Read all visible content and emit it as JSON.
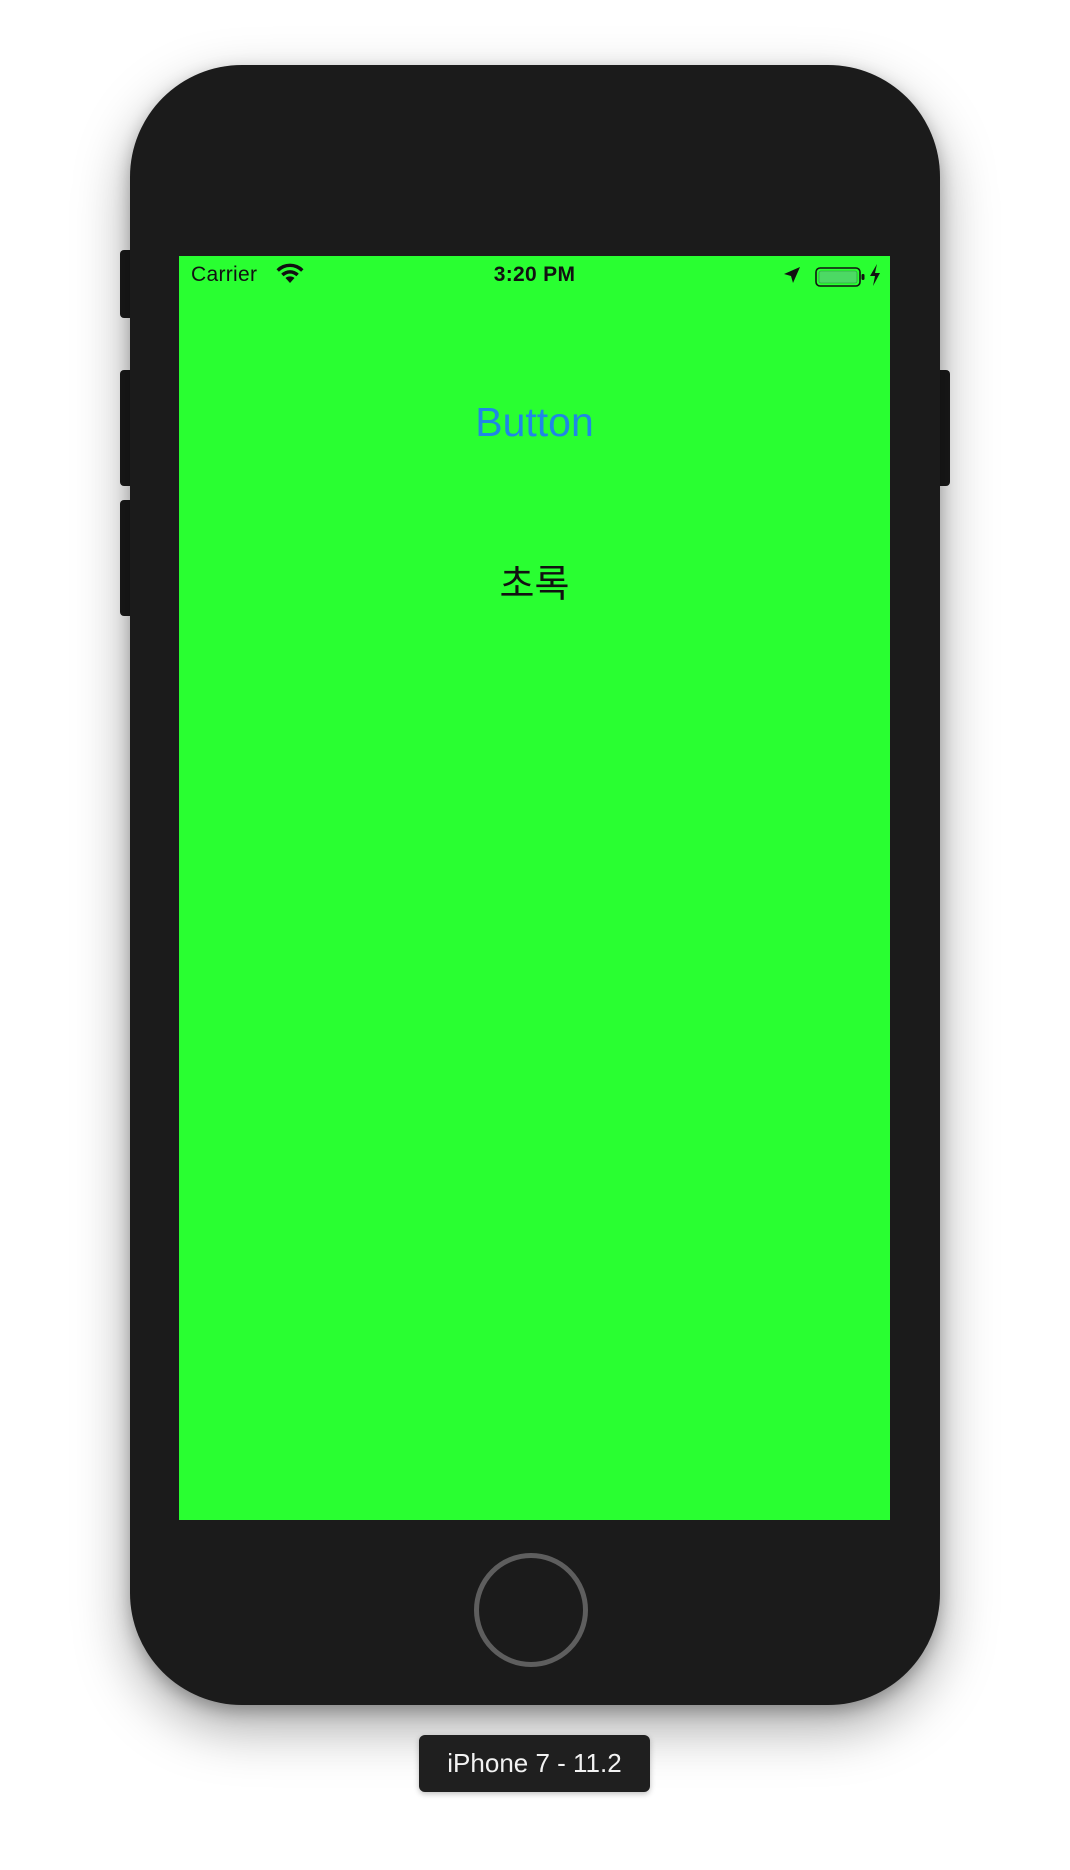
{
  "status_bar": {
    "carrier": "Carrier",
    "time": "3:20 PM",
    "icons": [
      "wifi-icon",
      "location-icon",
      "battery-icon",
      "charging-bolt-icon"
    ]
  },
  "app": {
    "button_label": "Button",
    "color_label": "초록",
    "background_color": "#29ff31",
    "button_color": "#1f87e6"
  },
  "simulator": {
    "device_label": "iPhone 7 - 11.2"
  }
}
